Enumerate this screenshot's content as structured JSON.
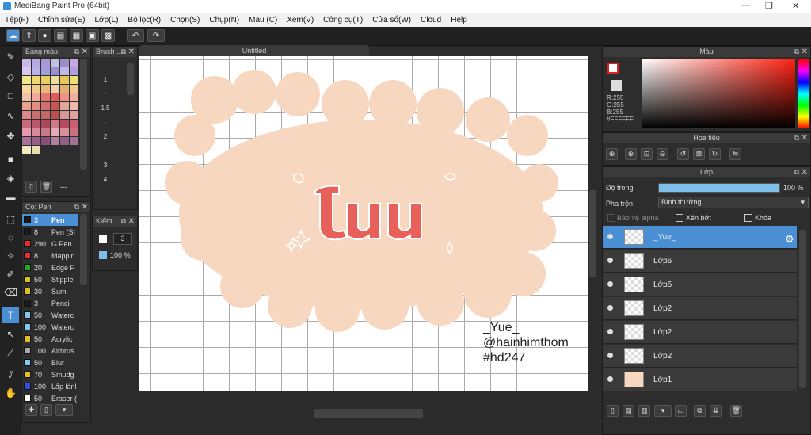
{
  "window": {
    "title": "MediBang Paint Pro (64bit)",
    "min": "—",
    "max": "❐",
    "close": "✕"
  },
  "menu": [
    "Tệp(F)",
    "Chỉnh sửa(E)",
    "Lớp(L)",
    "Bộ lọc(R)",
    "Chọn(S)",
    "Chụp(N)",
    "Màu (C)",
    "Xem(V)",
    "Công cụ(T)",
    "Cửa sổ(W)",
    "Cloud",
    "Help"
  ],
  "palette_panel": {
    "title": "Bảng màu",
    "footer_label": "---"
  },
  "brush_size_panel": {
    "title": "Brush ...",
    "sizes": [
      "1",
      "·",
      "1.5",
      "·",
      "2",
      "·",
      "3",
      "4"
    ]
  },
  "brush_panel": {
    "title": "Cọ: Pen",
    "items": [
      {
        "size": "3",
        "name": "Pen",
        "color": "#1a1a1a"
      },
      {
        "size": "8",
        "name": "Pen (SI",
        "color": "#1a1a1a"
      },
      {
        "size": "290",
        "name": "G Pen",
        "color": "#e03030"
      },
      {
        "size": "8",
        "name": "Mappin",
        "color": "#e03030"
      },
      {
        "size": "20",
        "name": "Edge P",
        "color": "#22aa22"
      },
      {
        "size": "50",
        "name": "Stipple",
        "color": "#e0c020"
      },
      {
        "size": "30",
        "name": "Sumi",
        "color": "#e0c020"
      },
      {
        "size": "3",
        "name": "Pencil",
        "color": "#1a1a1a"
      },
      {
        "size": "50",
        "name": "Waterc",
        "color": "#7fc8f0"
      },
      {
        "size": "100",
        "name": "Waterc",
        "color": "#7fc8f0"
      },
      {
        "size": "50",
        "name": "Acrylic",
        "color": "#e0c020"
      },
      {
        "size": "100",
        "name": "Airbrus",
        "color": "#aaaaaa"
      },
      {
        "size": "50",
        "name": "Blur",
        "color": "#7fc8f0"
      },
      {
        "size": "70",
        "name": "Smudg",
        "color": "#e0c020"
      },
      {
        "size": "100",
        "name": "Lấp lánl",
        "color": "#3050e0"
      },
      {
        "size": "50",
        "name": "Eraser (",
        "color": "#ffffff"
      }
    ]
  },
  "check_panel": {
    "title": "Kiểm ...",
    "size_value": "3",
    "opacity_value": "100 %"
  },
  "canvas": {
    "tab_title": "Untitled",
    "credit_lines": [
      "_Yue_",
      "@hainhimthom",
      "#hd247"
    ],
    "art_colors": {
      "background_blob": "#f7d7c0",
      "lettering": "#e8605a"
    }
  },
  "color_panel": {
    "title": "Màu",
    "r": "R:255",
    "g": "G:255",
    "b": "B:255",
    "hex": "#FFFFFF"
  },
  "navigator_panel": {
    "title": "Hoa tiêu"
  },
  "layer_panel": {
    "title": "Lớp",
    "opacity_label": "Độ trong",
    "opacity_value": "100 %",
    "opacity_fraction": 1.0,
    "blend_label": "Pha trộn",
    "blend_value": "Bình thường",
    "protect_alpha": "Bảo vệ alpha",
    "clipping": "Xén bớt",
    "lock": "Khóa",
    "layers": [
      {
        "name": "_Yue_",
        "selected": true
      },
      {
        "name": "Lớp6",
        "selected": false
      },
      {
        "name": "Lớp5",
        "selected": false
      },
      {
        "name": "Lớp2",
        "selected": false
      },
      {
        "name": "Lớp2",
        "selected": false
      },
      {
        "name": "Lớp2",
        "selected": false
      },
      {
        "name": "Lớp1",
        "selected": false
      }
    ]
  },
  "icons": {
    "toolbar": [
      "cloud-icon",
      "share-icon",
      "chat-icon",
      "comment-icon",
      "page-icon",
      "manga-icon",
      "grid-icon",
      "undo-icon",
      "redo-icon"
    ],
    "tools": [
      "brush-icon",
      "eraser-icon",
      "rectangle-icon",
      "curve-icon",
      "move-icon",
      "fill-rect-icon",
      "bucket-icon",
      "gradient-icon",
      "select-icon",
      "lasso-icon",
      "magic-wand-icon",
      "select-pen-icon",
      "select-eraser-icon",
      "text-icon",
      "operation-icon",
      "eyedropper-icon",
      "divide-icon",
      "hand-icon"
    ]
  }
}
